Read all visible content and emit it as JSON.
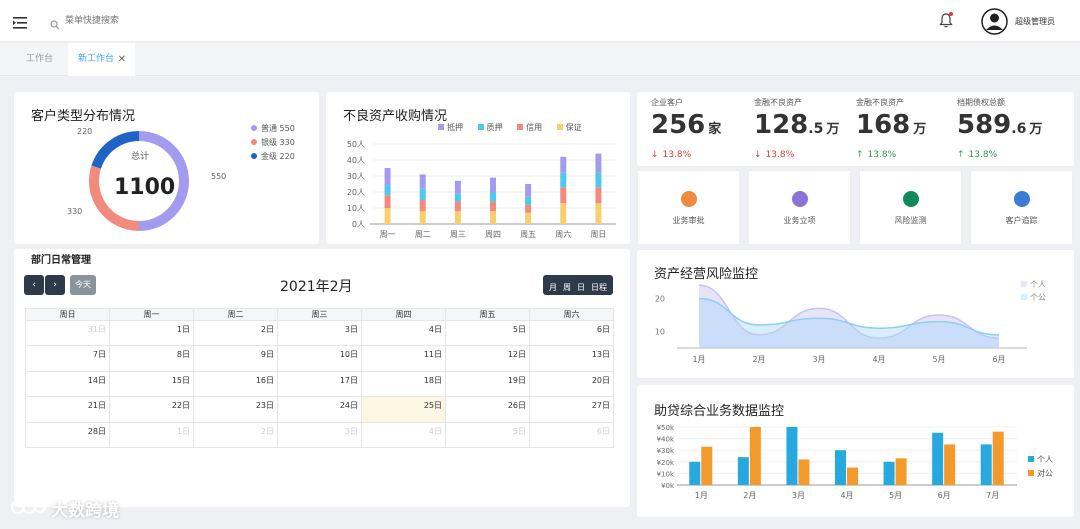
{
  "topbar": {
    "search_placeholder": "菜单快捷搜索",
    "user_name": "超级管理员"
  },
  "tabs": [
    {
      "label": "工作台"
    },
    {
      "label": "新工作台"
    }
  ],
  "customer_dist": {
    "title": "客户类型分布情况",
    "center_label": "总计",
    "total": "1100",
    "legend": [
      {
        "name": "普通",
        "value": "550",
        "color": "#a29bf0"
      },
      {
        "name": "银级",
        "value": "330",
        "color": "#f28b7d"
      },
      {
        "name": "金级",
        "value": "220",
        "color": "#1f63c7"
      }
    ],
    "labels": {
      "a": "550",
      "b": "330",
      "c": "220"
    },
    "chart_data": {
      "type": "pie",
      "categories": [
        "普通",
        "银级",
        "金级"
      ],
      "values": [
        550,
        330,
        220
      ]
    }
  },
  "bad_assets": {
    "title": "不良资产收购情况",
    "legend": [
      {
        "name": "抵押",
        "color": "#a29bf0"
      },
      {
        "name": "质押",
        "color": "#4dc8f0"
      },
      {
        "name": "信用",
        "color": "#f28b7d"
      },
      {
        "name": "保证",
        "color": "#f7cf6e"
      }
    ],
    "y_ticks": [
      "50人",
      "40人",
      "30人",
      "20人",
      "10人",
      "0人"
    ],
    "chart_data": {
      "type": "bar",
      "stacked": true,
      "categories": [
        "周一",
        "周二",
        "周三",
        "周四",
        "周五",
        "周六",
        "周日"
      ],
      "ylim": [
        0,
        50
      ],
      "series": [
        {
          "name": "保证",
          "values": [
            10,
            8,
            8,
            8,
            7,
            13,
            13
          ]
        },
        {
          "name": "信用",
          "values": [
            8,
            7,
            6,
            6,
            5,
            10,
            10
          ]
        },
        {
          "name": "质押",
          "values": [
            6,
            7,
            5,
            6,
            5,
            9,
            9
          ]
        },
        {
          "name": "抵押",
          "values": [
            11,
            9,
            8,
            9,
            8,
            10,
            12
          ]
        }
      ]
    }
  },
  "stats": [
    {
      "label": "企业客户",
      "main": "256",
      "dec": "",
      "unit": "家",
      "change": "13.8%",
      "dir": "down"
    },
    {
      "label": "金融不良资产",
      "main": "128",
      "dec": ".5",
      "unit": "万",
      "change": "13.8%",
      "dir": "down"
    },
    {
      "label": "金融不良资产",
      "main": "168",
      "dec": "",
      "unit": "万",
      "change": "13.8%",
      "dir": "up"
    },
    {
      "label": "档期债权总额",
      "main": "589",
      "dec": ".6",
      "unit": "万",
      "change": "13.8%",
      "dir": "up"
    }
  ],
  "arrows": {
    "down": "↓",
    "up": "↑"
  },
  "quick": [
    {
      "label": "业务审批",
      "color": "#f08a3c"
    },
    {
      "label": "业务立项",
      "color": "#8a73d6"
    },
    {
      "label": "风险监测",
      "color": "#0f8a5c"
    },
    {
      "label": "客户追踪",
      "color": "#3a7bd5"
    }
  ],
  "calendar": {
    "section_title": "部门日常管理",
    "today_btn": "今天",
    "title": "2021年2月",
    "views": [
      "月",
      "周",
      "日",
      "日程"
    ],
    "weekdays": [
      "周日",
      "周一",
      "周二",
      "周三",
      "周四",
      "周五",
      "周六"
    ],
    "weeks": [
      [
        "31日",
        "1日",
        "2日",
        "3日",
        "4日",
        "5日",
        "6日"
      ],
      [
        "7日",
        "8日",
        "9日",
        "10日",
        "11日",
        "12日",
        "13日"
      ],
      [
        "14日",
        "15日",
        "16日",
        "17日",
        "18日",
        "19日",
        "20日"
      ],
      [
        "21日",
        "22日",
        "23日",
        "24日",
        "25日",
        "26日",
        "27日"
      ],
      [
        "28日",
        "1日",
        "2日",
        "3日",
        "4日",
        "5日",
        "6日"
      ]
    ]
  },
  "risk": {
    "title": "资产经营风险监控",
    "legend": [
      "个人",
      "个公"
    ],
    "y_ticks": [
      "20",
      "10"
    ],
    "chart_data": {
      "type": "area",
      "categories": [
        "1月",
        "2月",
        "3月",
        "4月",
        "5月",
        "6月"
      ],
      "series": [
        {
          "name": "个人",
          "values": [
            24,
            9,
            17,
            8,
            15,
            8
          ]
        },
        {
          "name": "个公",
          "values": [
            20,
            12,
            14,
            11,
            13,
            9
          ]
        }
      ]
    }
  },
  "loan": {
    "title": "助贷综合业务数据监控",
    "legend": [
      {
        "name": "个人",
        "color": "#27a8df"
      },
      {
        "name": "对公",
        "color": "#f39a2d"
      }
    ],
    "y_ticks": [
      "¥50k",
      "¥40k",
      "¥30k",
      "¥20k",
      "¥10k",
      "¥0k"
    ],
    "chart_data": {
      "type": "bar",
      "categories": [
        "1月",
        "2月",
        "3月",
        "4月",
        "5月",
        "6月",
        "7月"
      ],
      "ylim": [
        0,
        50
      ],
      "series": [
        {
          "name": "个人",
          "values": [
            20,
            24,
            50,
            30,
            20,
            45,
            35
          ]
        },
        {
          "name": "对公",
          "values": [
            33,
            50,
            22,
            15,
            23,
            35,
            46
          ]
        }
      ]
    }
  },
  "watermark": "大数跨境"
}
